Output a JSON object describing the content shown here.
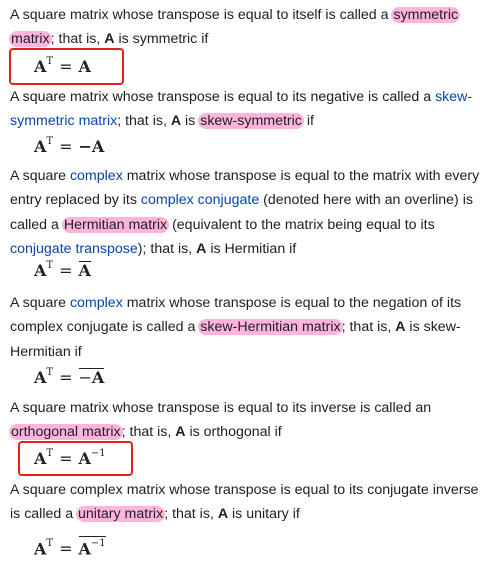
{
  "sections": [
    {
      "p1": "A square matrix whose transpose is equal to itself is called a ",
      "term": "symmetric matrix",
      "p2": "; that is, ",
      "A": "A",
      "p3": " is symmetric if",
      "formula_lhs": "A",
      "formula_sup": "T",
      "formula_eq": "=",
      "formula_rhs": "A"
    },
    {
      "p1": "A square matrix whose transpose is equal to its negative is called a ",
      "link": "skew-symmetric matrix",
      "p2": "; that is, ",
      "A": "A",
      "p3": " is ",
      "term": "skew-symmetric",
      "p4": " if",
      "formula_lhs": "A",
      "formula_sup": "T",
      "formula_eq": "=",
      "formula_rhs": "−A"
    },
    {
      "p1": "A square ",
      "link1": "complex",
      "p2": " matrix whose transpose is equal to the matrix with every entry replaced by its ",
      "link2": "complex conjugate",
      "p3": " (denoted here with an overline) is called a ",
      "term": "Hermitian matrix",
      "p4": " (equivalent to the matrix being equal to its ",
      "link3": "conjugate transpose",
      "p5": "); that is, ",
      "A": "A",
      "p6": " is Hermitian if",
      "formula_lhs": "A",
      "formula_sup": "T",
      "formula_eq": "=",
      "formula_rhs": "A"
    },
    {
      "p1": "A square ",
      "link1": "complex",
      "p2": " matrix whose transpose is equal to the negation of its complex conjugate is called a ",
      "term": "skew-Hermitian matrix",
      "p3": "; that is, ",
      "A": "A",
      "p4": " is skew-Hermitian if",
      "formula_lhs": "A",
      "formula_sup": "T",
      "formula_eq": "=",
      "formula_rhs_minus": "−",
      "formula_rhs": "A"
    },
    {
      "p1": "A square matrix whose transpose is equal to its inverse is called an ",
      "term": "orthogonal matrix",
      "p2": "; that is, ",
      "A": "A",
      "p3": " is orthogonal if",
      "formula_lhs": "A",
      "formula_sup": "T",
      "formula_eq": "=",
      "formula_rhs": "A",
      "formula_rhs_sup": "−1"
    },
    {
      "p1": "A square complex matrix whose transpose is equal to its conjugate inverse is called a ",
      "term": "unitary matrix",
      "p2": "; that is, ",
      "A": "A",
      "p3": " is unitary if",
      "formula_lhs": "A",
      "formula_sup": "T",
      "formula_eq": "=",
      "formula_rhs": "A",
      "formula_rhs_sup": "−1"
    }
  ],
  "colors": {
    "highlight": "#ffb3dd",
    "link": "#0645ad",
    "annotation_box": "#e2231a"
  }
}
